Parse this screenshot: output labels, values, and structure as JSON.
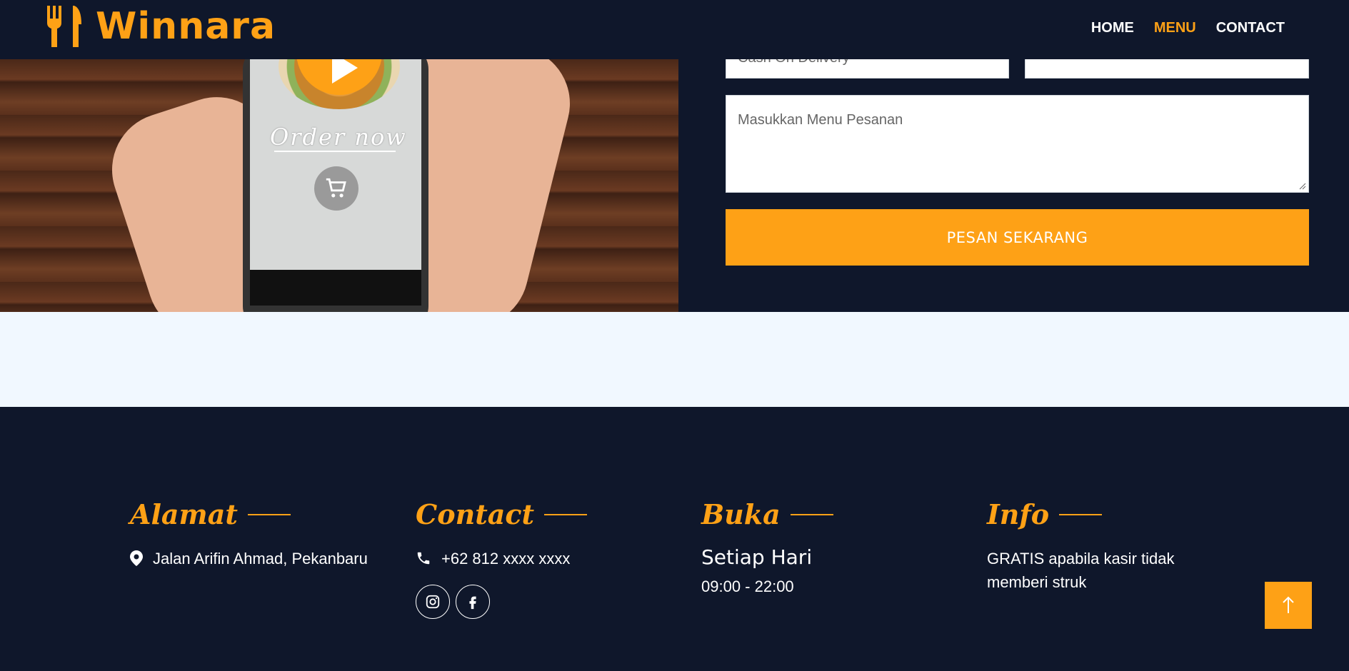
{
  "header": {
    "brand_name": "Winnara",
    "nav": [
      {
        "label": "HOME",
        "active": false
      },
      {
        "label": "MENU",
        "active": true
      },
      {
        "label": "CONTACT",
        "active": false
      }
    ]
  },
  "hero": {
    "image_text": "Order now"
  },
  "form": {
    "payment_value": "Cash On Delivery",
    "menu_placeholder": "Masukkan Menu Pesanan",
    "submit_label": "PESAN SEKARANG"
  },
  "footer": {
    "address": {
      "title": "Alamat",
      "text": "Jalan Arifin Ahmad, Pekanbaru"
    },
    "contact": {
      "title": "Contact",
      "phone": "+62 812 xxxx xxxx"
    },
    "hours": {
      "title": "Buka",
      "day": "Setiap Hari",
      "time": "09:00 - 22:00"
    },
    "info": {
      "title": "Info",
      "text": "GRATIS apabila kasir tidak memberi struk"
    }
  },
  "colors": {
    "accent": "#fea116",
    "dark": "#0f172b",
    "light_band": "#f1f8ff"
  },
  "icons": [
    "utensils-icon",
    "play-icon",
    "cart-icon",
    "map-marker-icon",
    "phone-icon",
    "instagram-icon",
    "facebook-icon",
    "arrow-up-icon"
  ]
}
